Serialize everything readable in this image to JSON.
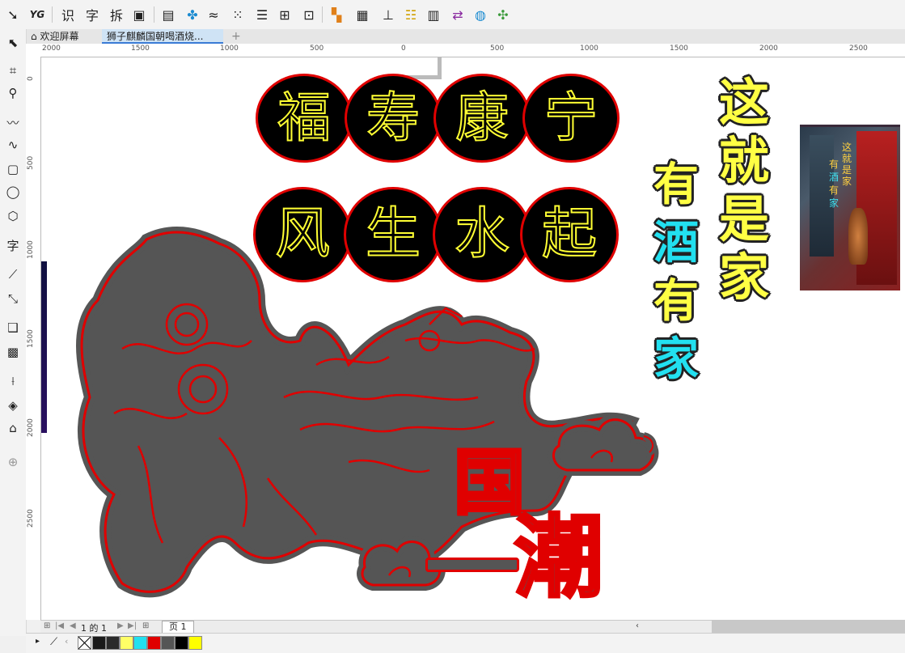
{
  "toolbar": {
    "buttons": [
      {
        "name": "pick-tool-icon",
        "glyph": "➘"
      },
      {
        "name": "yg-plugin-icon",
        "glyph": "YG"
      },
      {
        "name": "recognize-icon",
        "glyph": "识"
      },
      {
        "name": "text-icon",
        "glyph": "字"
      },
      {
        "name": "split-icon",
        "glyph": "拆"
      },
      {
        "name": "copy-icon",
        "glyph": "▣"
      },
      {
        "name": "table-icon",
        "glyph": "▤"
      },
      {
        "name": "pattern-icon",
        "glyph": "✤"
      },
      {
        "name": "wave-icon",
        "glyph": "≈"
      },
      {
        "name": "node-align-icon",
        "glyph": "⁙"
      },
      {
        "name": "lines-icon",
        "glyph": "☰"
      },
      {
        "name": "group-icon",
        "glyph": "⊞"
      },
      {
        "name": "frame-select-icon",
        "glyph": "⊡"
      },
      {
        "name": "color-blocks-icon",
        "glyph": "▚"
      },
      {
        "name": "image-icon",
        "glyph": "▦"
      },
      {
        "name": "text-align-icon",
        "glyph": "⊥"
      },
      {
        "name": "list-icon",
        "glyph": "☷"
      },
      {
        "name": "barcode-icon",
        "glyph": "▥"
      },
      {
        "name": "swap-icon",
        "glyph": "⇄"
      },
      {
        "name": "globe-icon",
        "glyph": "◍"
      },
      {
        "name": "puzzle-icon",
        "glyph": "✣"
      }
    ]
  },
  "tabs": {
    "home_label": "欢迎屏幕",
    "document_label": "狮子麒麟国朝喝酒烧...",
    "add_label": "+"
  },
  "ruler": {
    "h_labels": [
      "2000",
      "1500",
      "1000",
      "500",
      "0",
      "500",
      "1000",
      "1500",
      "2000",
      "2500"
    ],
    "v_labels": [
      "0",
      "500",
      "1000",
      "1500",
      "2000",
      "2500"
    ]
  },
  "artwork": {
    "row1": [
      "福",
      "寿",
      "康",
      "宁"
    ],
    "row2": [
      "风",
      "生",
      "水",
      "起"
    ],
    "col_yellow": [
      "这",
      "就",
      "是",
      "家"
    ],
    "col_mixed": [
      "有",
      "酒",
      "有",
      "家"
    ],
    "guochao": [
      "国",
      "潮"
    ],
    "photo_text": [
      "这就是家",
      "有",
      "酒",
      "有",
      "家"
    ]
  },
  "pagebar": {
    "page_count": "1 的 1",
    "page_tab": "页 1"
  },
  "palette": {
    "colors": [
      "#1a1a1a",
      "#2a2a2a",
      "#ffff66",
      "#22e0f0",
      "#e00000",
      "#555555",
      "#000000",
      "#ffff00"
    ]
  }
}
